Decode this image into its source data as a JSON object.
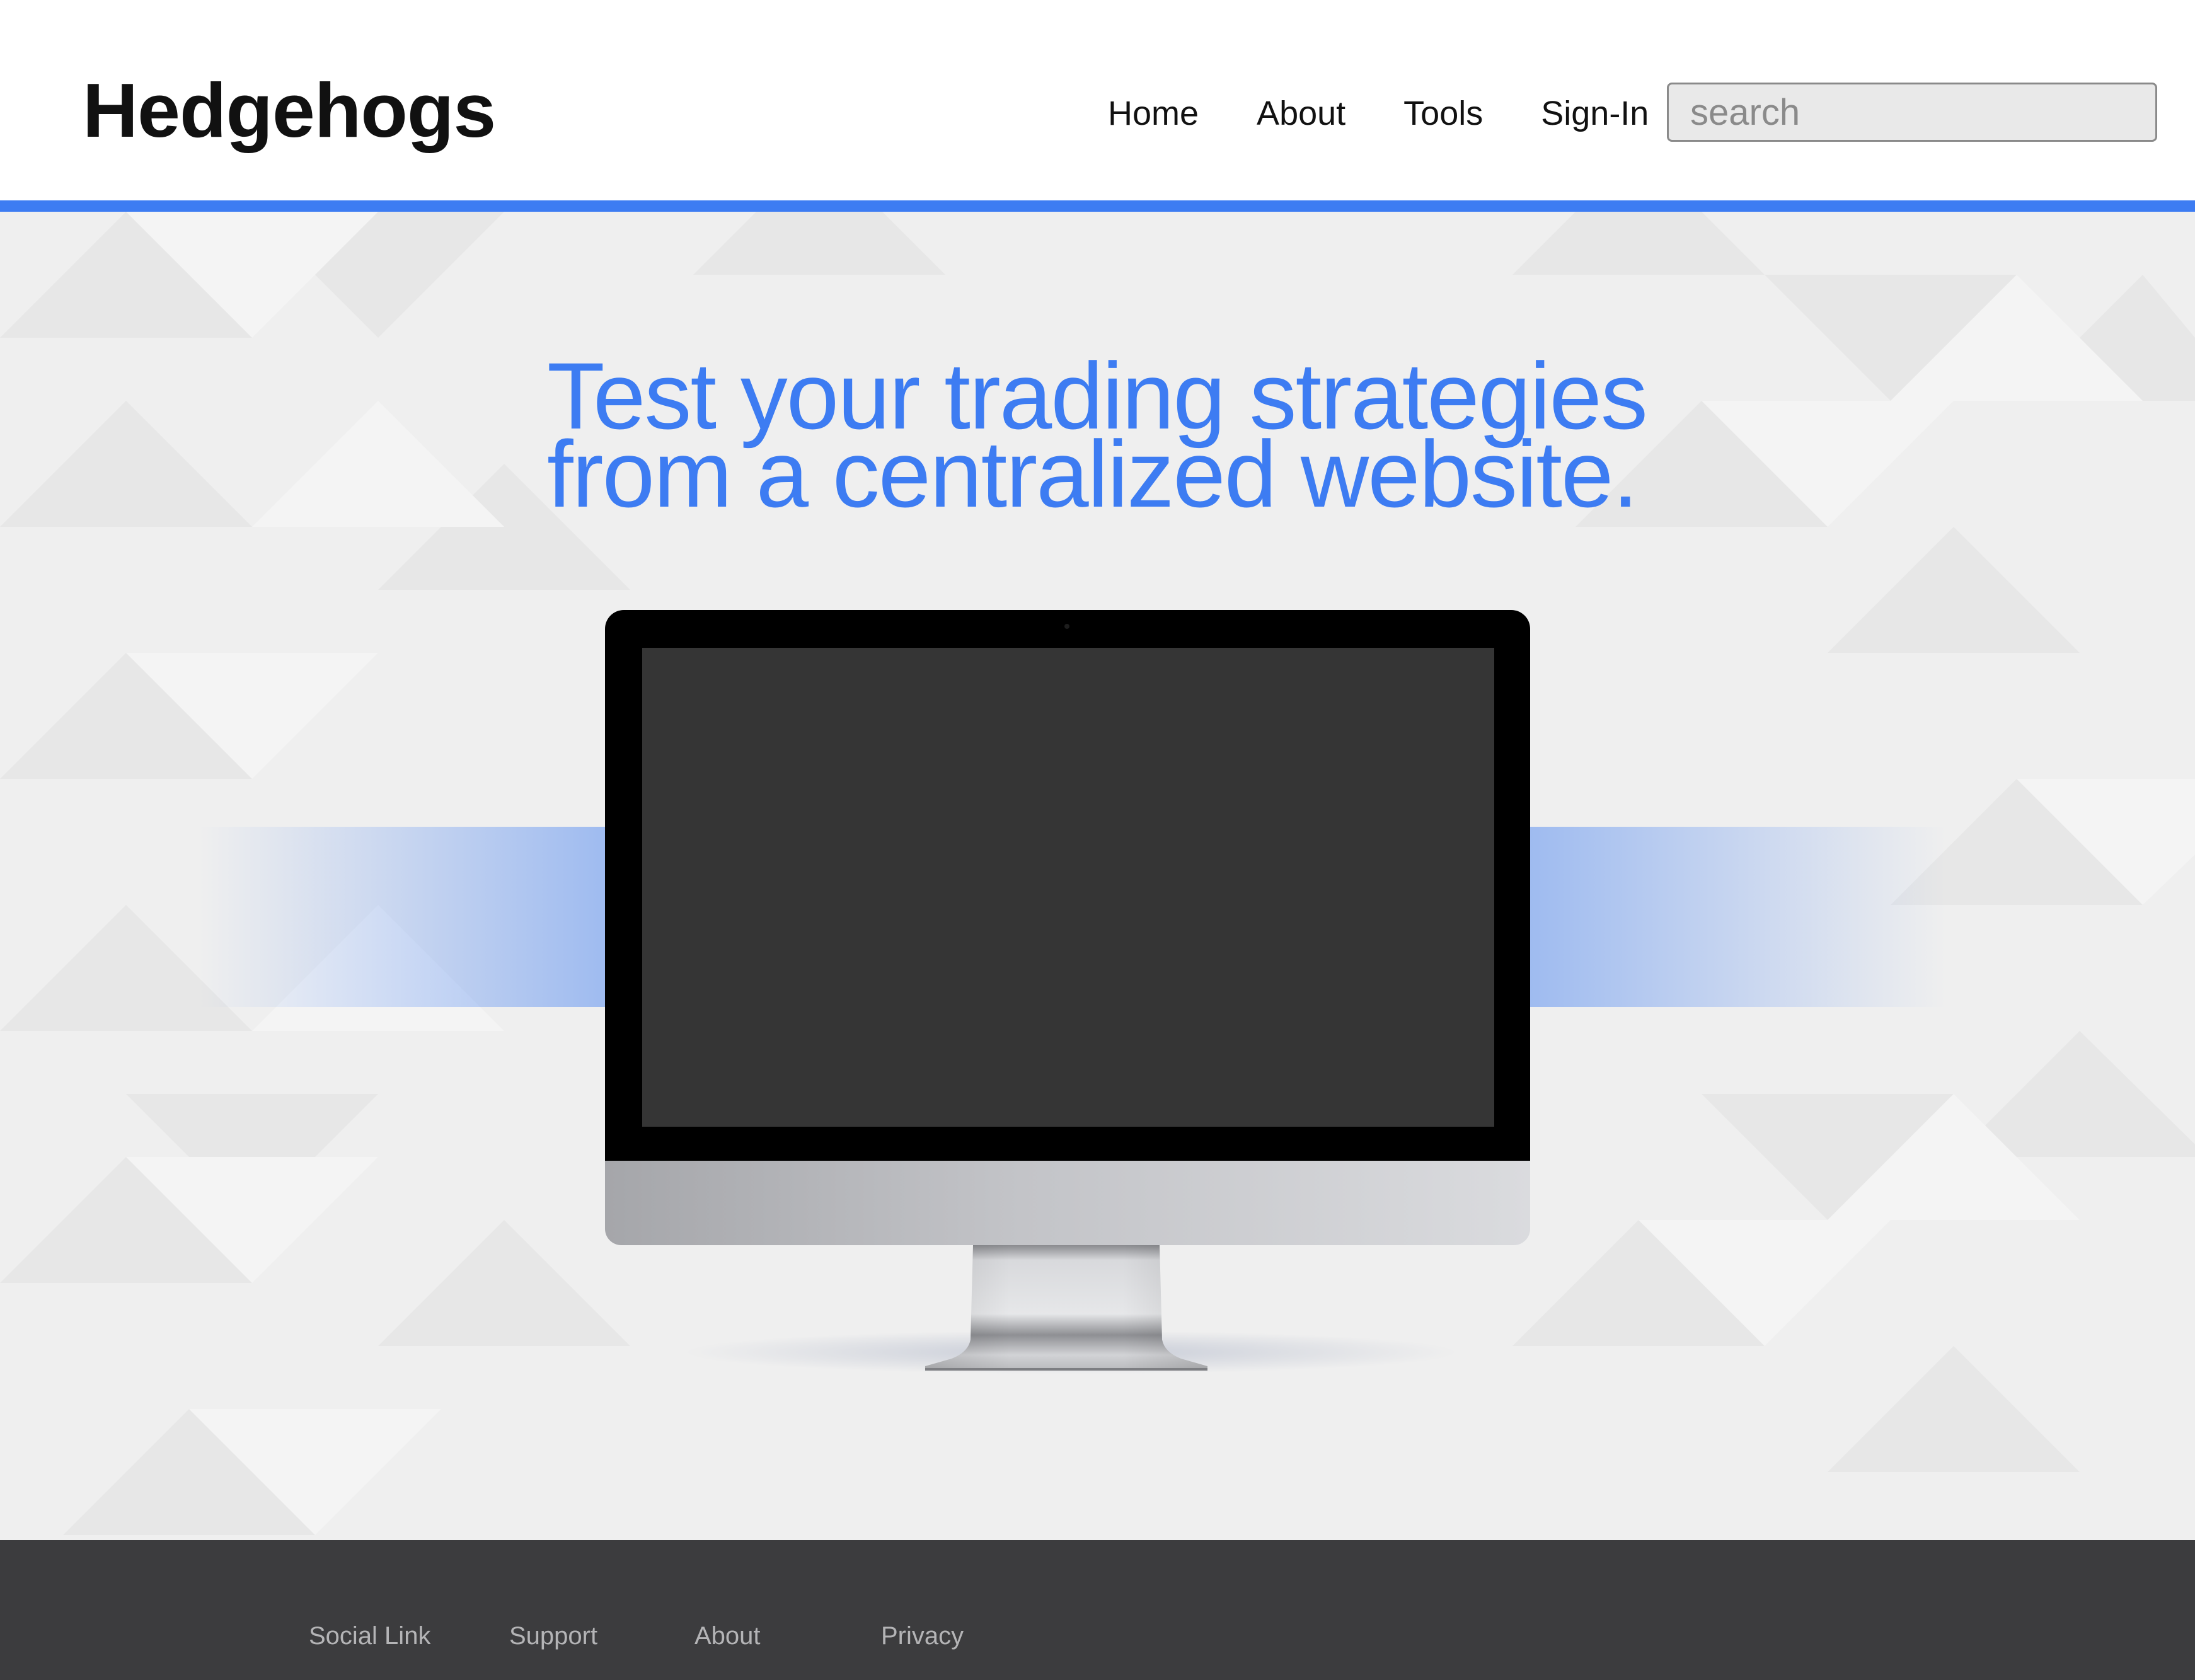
{
  "header": {
    "brand": "Hedgehogs",
    "nav": [
      "Home",
      "About",
      "Tools",
      "Sign-In"
    ],
    "search_placeholder": "search"
  },
  "hero": {
    "headline_line1": "Test your trading strategies",
    "headline_line2": "from a centralized website."
  },
  "footer": {
    "links": [
      "Social Link",
      "Support",
      "About",
      "Privacy"
    ]
  },
  "colors": {
    "accent": "#3d7cf2",
    "hero_background": "#efefef",
    "footer_background": "#3c3c3e",
    "screen": "#353535"
  }
}
